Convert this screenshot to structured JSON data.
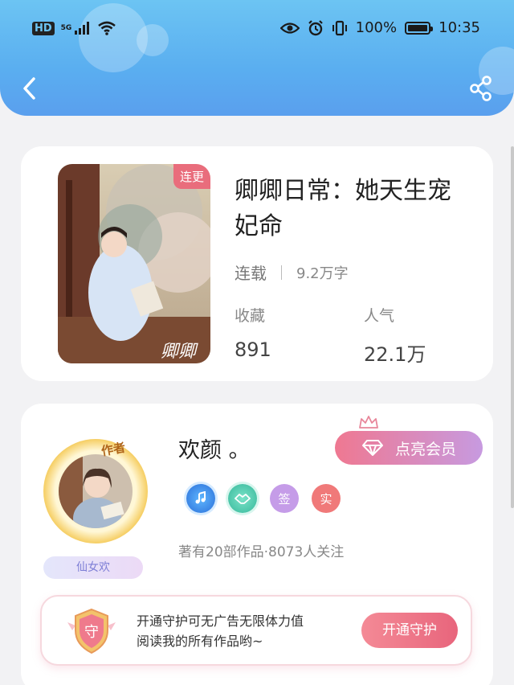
{
  "status_bar": {
    "hd": "HD",
    "network": "5G",
    "battery_percent": "100%",
    "battery_level": 1.0,
    "time": "10:35"
  },
  "nav": {
    "back_icon": "chevron-left-icon",
    "share_icon": "share-icon"
  },
  "book": {
    "badge": "连更",
    "title": "卿卿日常：她天生宠妃命",
    "status": "连载",
    "word_count": "9.2万字",
    "favorites_label": "收藏",
    "favorites_value": "891",
    "popularity_label": "人气",
    "popularity_value": "22.1万"
  },
  "author": {
    "tag": "作者",
    "name": "欢颜 。",
    "subtitle": "仙女欢",
    "vip_button": "点亮会员",
    "badges": [
      "music-badge-icon",
      "handshake-badge-icon",
      "签",
      "实"
    ],
    "stats": "著有20部作品·8073人关注"
  },
  "guard": {
    "shield_label": "守",
    "text_line1": "开通守护可无广告无限体力值",
    "text_line2": "阅读我的所有作品哟~",
    "button": "开通守护"
  },
  "colors": {
    "header_blue": "#5aaef0",
    "accent_pink": "#e96d7c",
    "vip_gradient_start": "#ef7891",
    "vip_gradient_end": "#c79ae0"
  }
}
